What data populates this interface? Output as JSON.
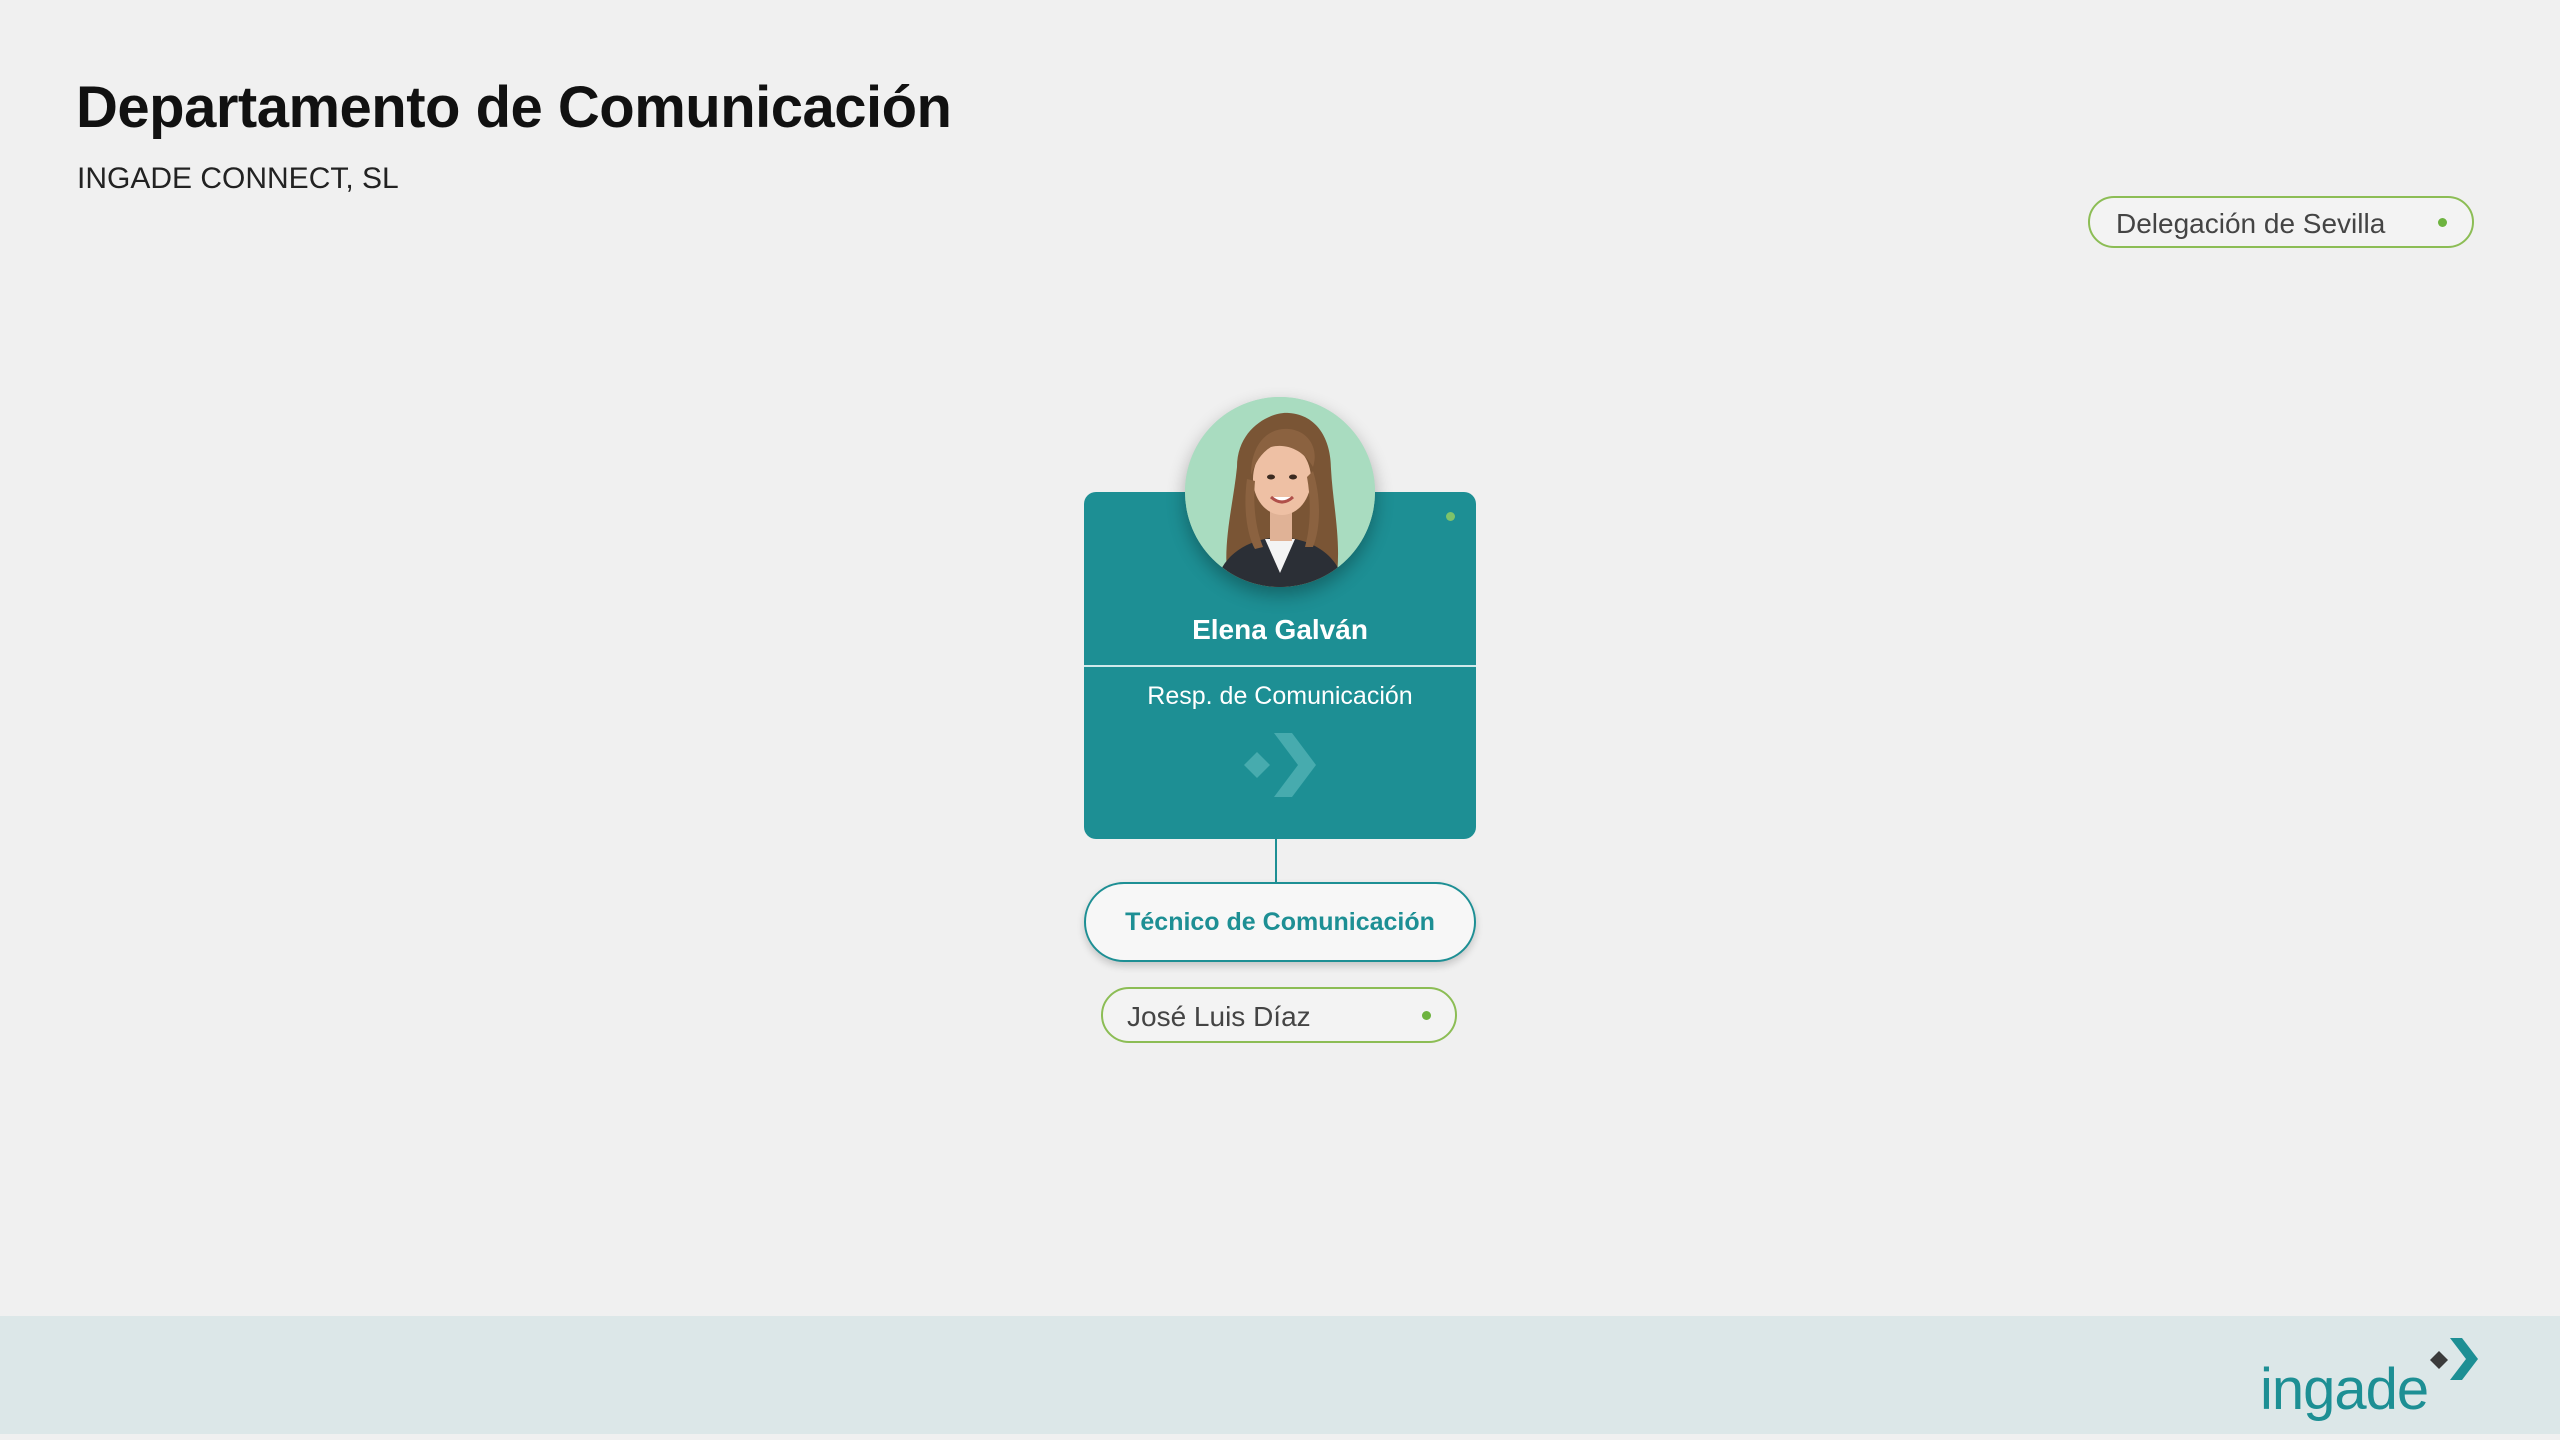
{
  "header": {
    "title": "Departamento de Comunicación",
    "subtitle": "INGADE CONNECT, SL"
  },
  "location": {
    "label": "Delegación de Sevilla"
  },
  "manager": {
    "name": "Elena Galván",
    "role": "Resp. de Comunicación"
  },
  "team": {
    "role_label": "Técnico de Comunicación",
    "members": [
      "José Luis Díaz"
    ]
  },
  "brand": {
    "name": "ingade"
  },
  "colors": {
    "teal": "#1d8f94",
    "green_accent": "#8cbd55",
    "status_dot": "#6db33f",
    "footer_band": "#dce7e8",
    "background": "#f0f0f0"
  },
  "icons": {
    "card_mark": "ingade-arrow-icon",
    "status": "status-dot-icon",
    "avatar": "avatar-photo"
  }
}
